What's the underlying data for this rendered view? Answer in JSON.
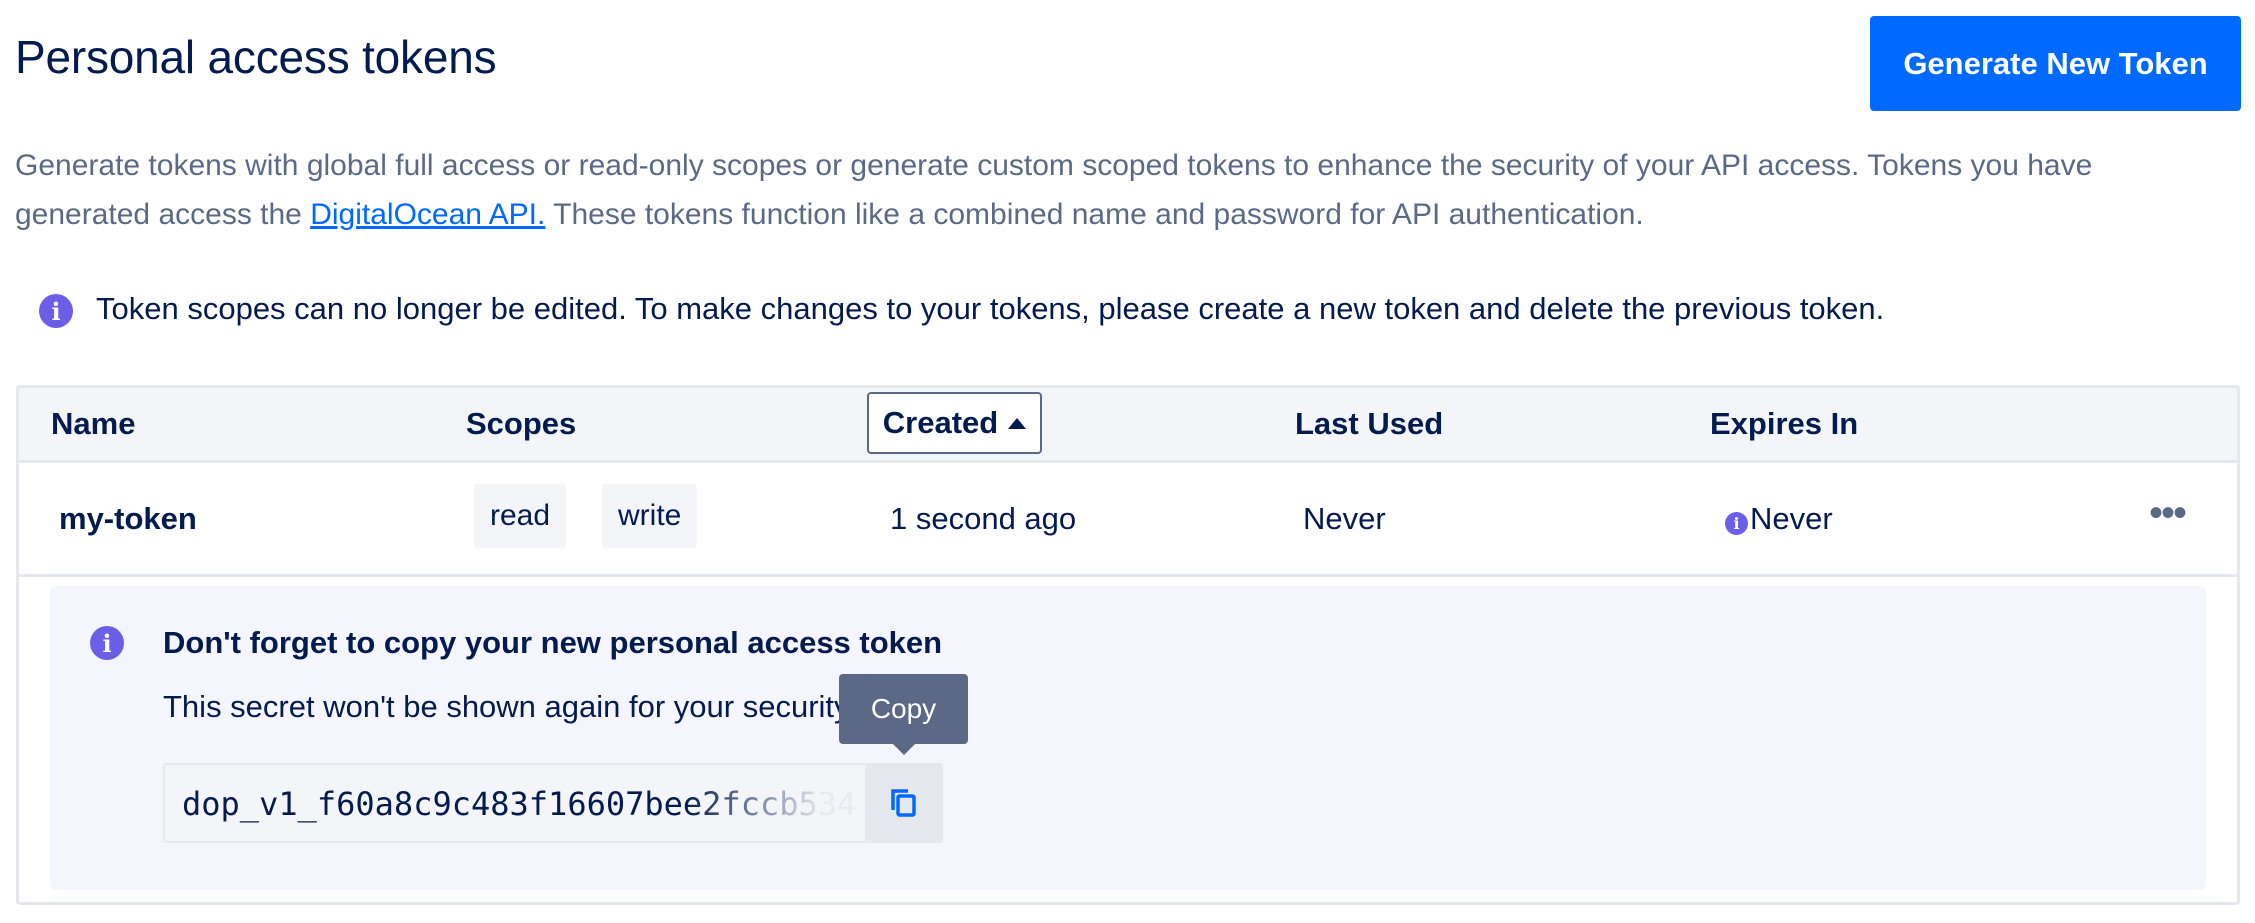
{
  "page": {
    "title": "Personal access tokens",
    "generate_button": "Generate New Token",
    "description_part1": "Generate tokens with global full access or read-only scopes or generate custom scoped tokens to enhance the security of your API access. Tokens you have generated access the ",
    "description_link": "DigitalOcean API.",
    "description_part2": " These tokens function like a combined name and password for API authentication.",
    "notice": "Token scopes can no longer be edited. To make changes to your tokens, please create a new token and delete the previous token."
  },
  "table": {
    "headers": {
      "name": "Name",
      "scopes": "Scopes",
      "created": "Created",
      "last_used": "Last Used",
      "expires_in": "Expires In"
    },
    "sort": {
      "column": "Created",
      "direction": "ascending"
    },
    "rows": [
      {
        "name": "my-token",
        "scopes": [
          "read",
          "write"
        ],
        "created": "1 second ago",
        "last_used": "Never",
        "expires_in": "Never"
      }
    ]
  },
  "new_token_panel": {
    "title": "Don't forget to copy your new personal access token",
    "subtitle": "This secret won't be shown again for your security.",
    "token_value": "dop_v1_f60a8c9c483f16607bee2fccb534",
    "copy_tooltip": "Copy"
  },
  "colors": {
    "accent": "#0069ff",
    "info": "#6b5fe8",
    "text": "#031b4e",
    "muted": "#5b6987"
  },
  "icons": {
    "info": "info-circle-icon",
    "copy": "copy-icon",
    "menu": "more-horizontal-icon",
    "sort": "caret-up-icon"
  }
}
